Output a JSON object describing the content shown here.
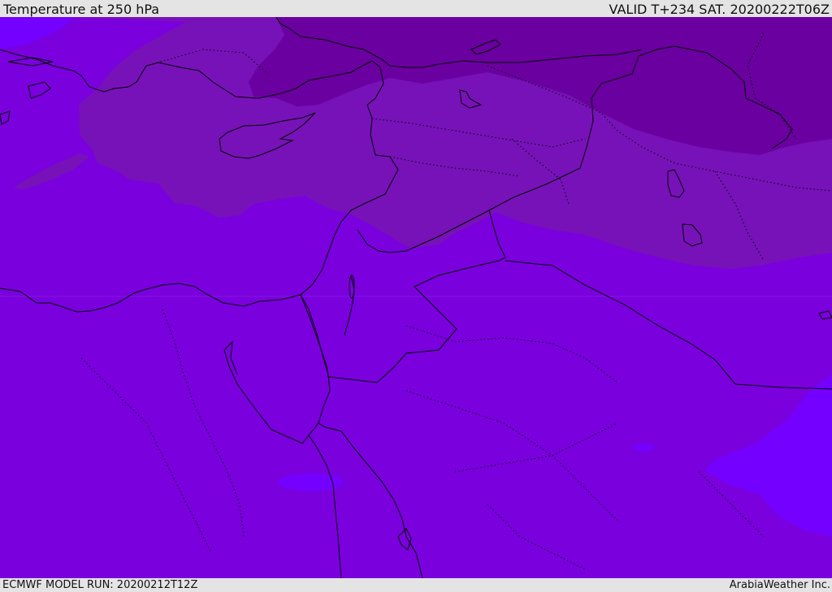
{
  "header": {
    "title": "Temperature at 250 hPa",
    "valid_time": "VALID T+234 SAT. 20200222T06Z"
  },
  "footer": {
    "model_run": "ECMWF MODEL RUN: 20200212T12Z",
    "credit": "ArabiaWeather Inc."
  },
  "map": {
    "colors": {
      "band_base": "#7a00de",
      "band_warm": "#7400ff",
      "band_cool": "#7712b8",
      "band_cold": "#6a00a0",
      "coastline": "#000000"
    }
  }
}
